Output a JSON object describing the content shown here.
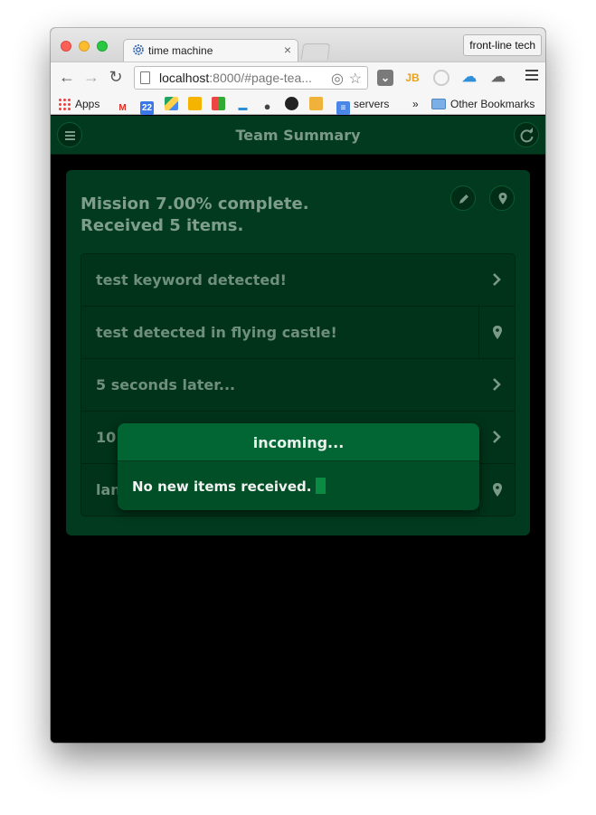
{
  "browser": {
    "tab_title": "time machine",
    "tab_close": "×",
    "profile": "front-line tech",
    "url_main": "localhost",
    "url_rest": ":8000/#page-tea...",
    "bookmarks": {
      "apps": "Apps",
      "calendar_day": "22",
      "servers": "servers",
      "overflow": "»",
      "other": "Other Bookmarks"
    }
  },
  "app": {
    "header_title": "Team Summary",
    "mission_line1": "Mission 7.00% complete.",
    "mission_line2": "Received 5 items.",
    "items": [
      {
        "label": "test keyword detected!",
        "action": "chevron-right-icon"
      },
      {
        "label": "test detected in flying castle!",
        "action": "map-pin-icon"
      },
      {
        "label": "5 seconds later...",
        "action": "chevron-right-icon"
      },
      {
        "label": "10",
        "action": "chevron-right-icon"
      },
      {
        "label": "lancaster gate",
        "action": "map-pin-icon"
      }
    ],
    "modal": {
      "title": "incoming...",
      "message": "No new items received."
    }
  },
  "colors": {
    "header_bg": "#013a1e",
    "modal_head": "#016633",
    "accent_green": "#0b8a43"
  }
}
